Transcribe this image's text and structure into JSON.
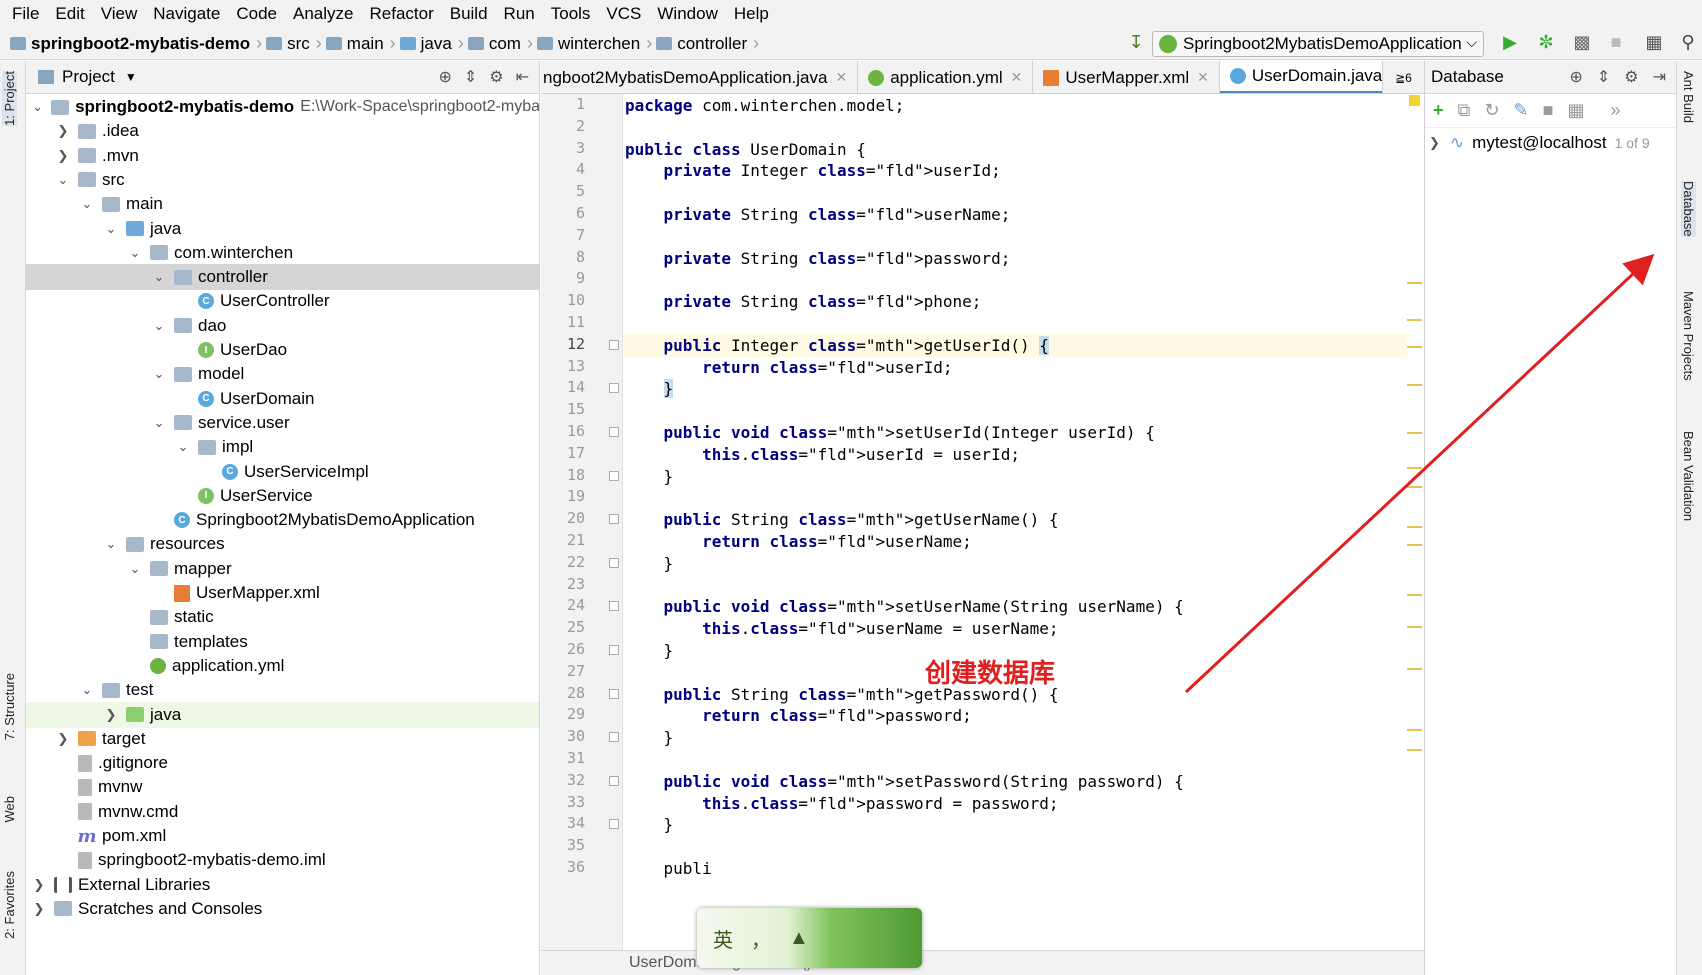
{
  "menu": [
    "File",
    "Edit",
    "View",
    "Navigate",
    "Code",
    "Analyze",
    "Refactor",
    "Build",
    "Run",
    "Tools",
    "VCS",
    "Window",
    "Help"
  ],
  "breadcrumb": [
    {
      "label": "springboot2-mybatis-demo",
      "bold": true
    },
    {
      "label": "src"
    },
    {
      "label": "main"
    },
    {
      "label": "java"
    },
    {
      "label": "com"
    },
    {
      "label": "winterchen"
    },
    {
      "label": "controller"
    }
  ],
  "run_config": "Springboot2MybatisDemoApplication",
  "left_strip": {
    "project": "1: Project",
    "structure": "7: Structure",
    "web": "Web",
    "favorites": "2: Favorites"
  },
  "project_panel": {
    "title": "Project",
    "root_name": "springboot2-mybatis-demo",
    "root_path": "E:\\Work-Space\\springboot2-myba",
    "items": [
      {
        "label": ".idea"
      },
      {
        "label": ".mvn"
      },
      {
        "label": "src"
      },
      {
        "label": "main"
      },
      {
        "label": "java"
      },
      {
        "label": "com.winterchen"
      },
      {
        "label": "controller"
      },
      {
        "label": "UserController"
      },
      {
        "label": "dao"
      },
      {
        "label": "UserDao"
      },
      {
        "label": "model"
      },
      {
        "label": "UserDomain"
      },
      {
        "label": "service.user"
      },
      {
        "label": "impl"
      },
      {
        "label": "UserServiceImpl"
      },
      {
        "label": "UserService"
      },
      {
        "label": "Springboot2MybatisDemoApplication"
      },
      {
        "label": "resources"
      },
      {
        "label": "mapper"
      },
      {
        "label": "UserMapper.xml"
      },
      {
        "label": "static"
      },
      {
        "label": "templates"
      },
      {
        "label": "application.yml"
      },
      {
        "label": "test"
      },
      {
        "label": "java"
      },
      {
        "label": "target"
      },
      {
        "label": ".gitignore"
      },
      {
        "label": "mvnw"
      },
      {
        "label": "mvnw.cmd"
      },
      {
        "label": "pom.xml"
      },
      {
        "label": "springboot2-mybatis-demo.iml"
      },
      {
        "label": "External Libraries"
      },
      {
        "label": "Scratches and Consoles"
      }
    ]
  },
  "editor_tabs": [
    {
      "label": "ngboot2MybatisDemoApplication.java"
    },
    {
      "label": "application.yml"
    },
    {
      "label": "UserMapper.xml"
    },
    {
      "label": "UserDomain.java",
      "active": true
    }
  ],
  "tabs_more": "≧6",
  "code_lines": [
    "package com.winterchen.model;",
    "",
    "public class UserDomain {",
    "    private Integer userId;",
    "",
    "    private String userName;",
    "",
    "    private String password;",
    "",
    "    private String phone;",
    "",
    "    public Integer getUserId() {",
    "        return userId;",
    "    }",
    "",
    "    public void setUserId(Integer userId) {",
    "        this.userId = userId;",
    "    }",
    "",
    "    public String getUserName() {",
    "        return userName;",
    "    }",
    "",
    "    public void setUserName(String userName) {",
    "        this.userName = userName;",
    "    }",
    "",
    "    public String getPassword() {",
    "        return password;",
    "    }",
    "",
    "    public void setPassword(String password) {",
    "        this.password = password;",
    "    }",
    "",
    "    publi"
  ],
  "current_line": 12,
  "editor_breadcrumb": "UserDomain  ›  getUserId()",
  "database_panel": {
    "title": "Database",
    "datasource": "mytest@localhost",
    "count": "1 of 9"
  },
  "right_strip": {
    "ant": "Ant Build",
    "database": "Database",
    "maven": "Maven Projects",
    "bean": "Bean Validation"
  },
  "annotation_text": "创建数据库",
  "ime": {
    "lang": "英",
    "punct": "，"
  },
  "colors": {
    "annotation": "#e02020",
    "selection": "#d5d5d5",
    "current_line": "#fffae3"
  }
}
